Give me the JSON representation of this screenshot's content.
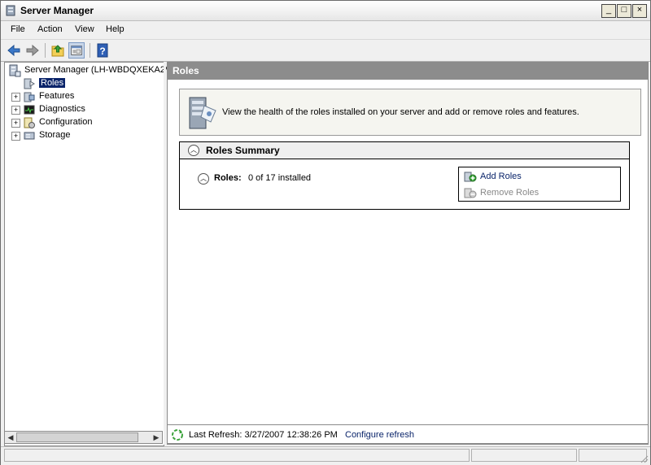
{
  "window": {
    "title": "Server Manager"
  },
  "menu": [
    "File",
    "Action",
    "View",
    "Help"
  ],
  "tree": {
    "root": "Server Manager (LH-WBDQXEKA2V",
    "items": [
      {
        "label": "Roles",
        "selected": true,
        "expander": ""
      },
      {
        "label": "Features",
        "selected": false,
        "expander": "+"
      },
      {
        "label": "Diagnostics",
        "selected": false,
        "expander": "+"
      },
      {
        "label": "Configuration",
        "selected": false,
        "expander": "+"
      },
      {
        "label": "Storage",
        "selected": false,
        "expander": "+"
      }
    ]
  },
  "main": {
    "header": "Roles",
    "description": "View the health of the roles installed on your server and add or remove roles and features.",
    "summary": {
      "title": "Roles Summary",
      "roles_label": "Roles:",
      "roles_count": "0 of 17 installed",
      "actions": {
        "add": "Add Roles",
        "remove": "Remove Roles"
      }
    },
    "status": {
      "last_refresh": "Last Refresh: 3/27/2007 12:38:26 PM",
      "configure_link": "Configure refresh"
    }
  },
  "colors": {
    "selection": "#0a246a",
    "header_gray": "#8c8c8c",
    "link": "#0a246a"
  },
  "icons": [
    "server-manager-icon",
    "back-arrow-icon",
    "forward-arrow-icon",
    "up-folder-icon",
    "show-hide-tree-icon",
    "help-icon",
    "refresh-icon"
  ]
}
